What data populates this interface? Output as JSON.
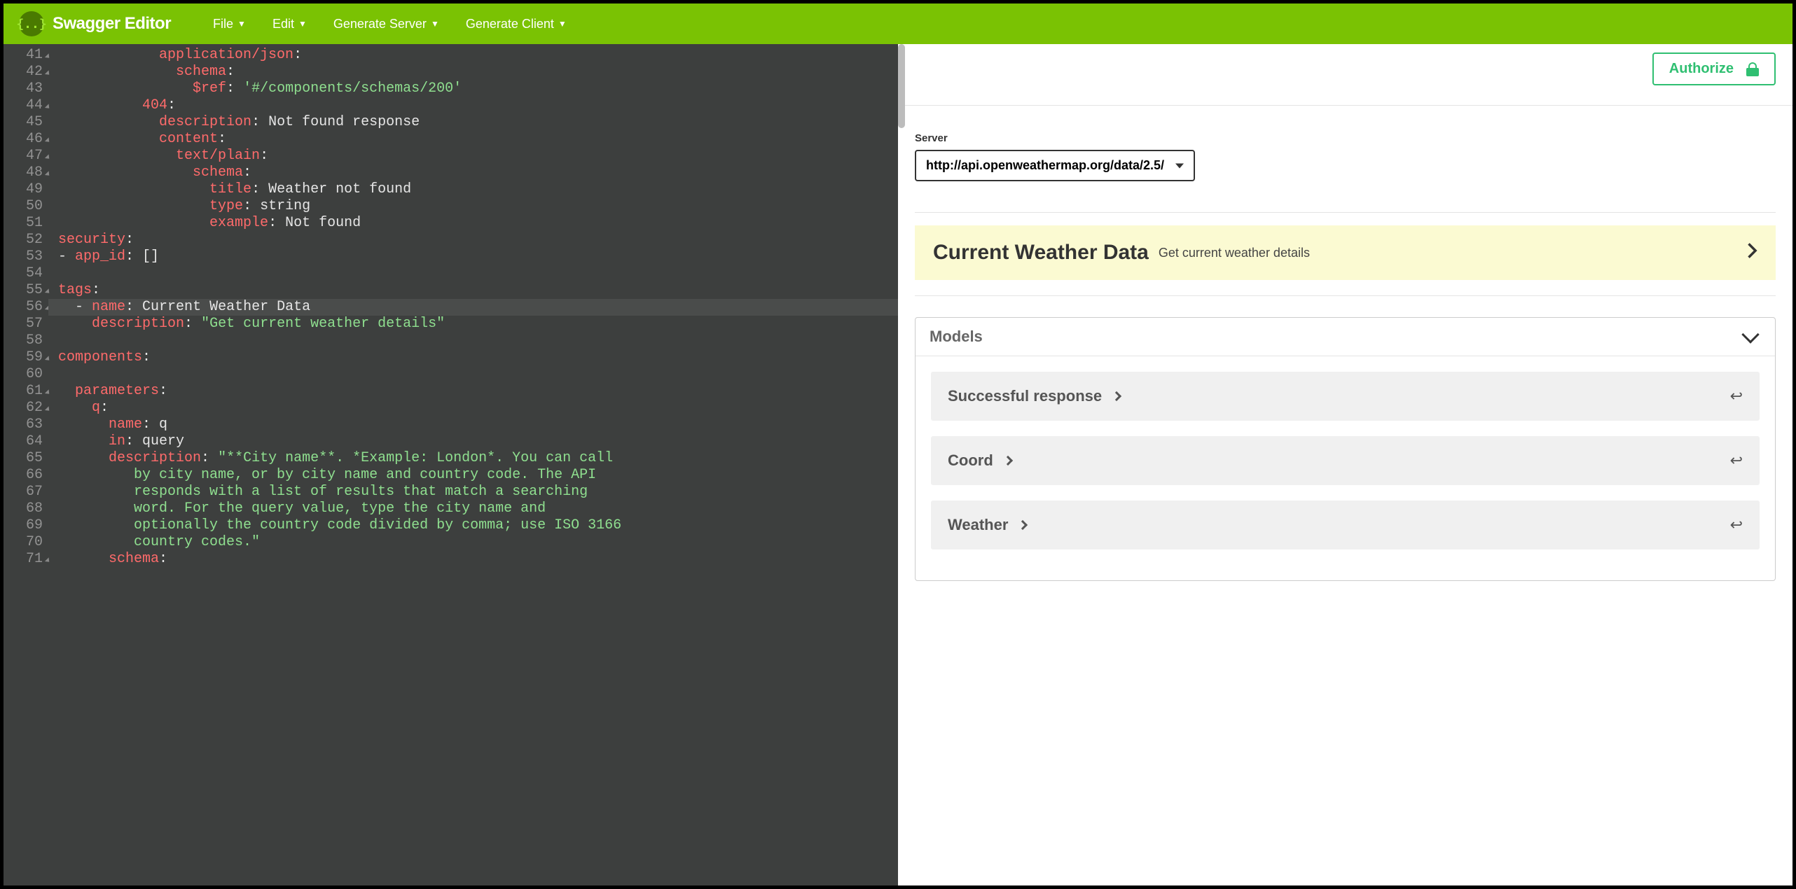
{
  "topbar": {
    "title": "Swagger Editor",
    "menu": [
      "File",
      "Edit",
      "Generate Server",
      "Generate Client"
    ]
  },
  "editor": {
    "first_line": 41,
    "highlighted_line": 56,
    "lines": [
      {
        "indent": 12,
        "fold": true,
        "tokens": [
          [
            "k",
            "application/json"
          ],
          [
            "p",
            ":"
          ]
        ]
      },
      {
        "indent": 14,
        "fold": true,
        "tokens": [
          [
            "k",
            "schema"
          ],
          [
            "p",
            ":"
          ]
        ]
      },
      {
        "indent": 16,
        "fold": false,
        "tokens": [
          [
            "k",
            "$ref"
          ],
          [
            "p",
            ": "
          ],
          [
            "s",
            "'#/components/schemas/200'"
          ]
        ]
      },
      {
        "indent": 10,
        "fold": true,
        "tokens": [
          [
            "k",
            "404"
          ],
          [
            "p",
            ":"
          ]
        ]
      },
      {
        "indent": 12,
        "fold": false,
        "tokens": [
          [
            "k",
            "description"
          ],
          [
            "p",
            ": Not found response"
          ]
        ]
      },
      {
        "indent": 12,
        "fold": true,
        "tokens": [
          [
            "k",
            "content"
          ],
          [
            "p",
            ":"
          ]
        ]
      },
      {
        "indent": 14,
        "fold": true,
        "tokens": [
          [
            "k",
            "text/plain"
          ],
          [
            "p",
            ":"
          ]
        ]
      },
      {
        "indent": 16,
        "fold": true,
        "tokens": [
          [
            "k",
            "schema"
          ],
          [
            "p",
            ":"
          ]
        ]
      },
      {
        "indent": 18,
        "fold": false,
        "tokens": [
          [
            "k",
            "title"
          ],
          [
            "p",
            ": Weather not found"
          ]
        ]
      },
      {
        "indent": 18,
        "fold": false,
        "tokens": [
          [
            "k",
            "type"
          ],
          [
            "p",
            ": string"
          ]
        ]
      },
      {
        "indent": 18,
        "fold": false,
        "tokens": [
          [
            "k",
            "example"
          ],
          [
            "p",
            ": Not found"
          ]
        ]
      },
      {
        "indent": 0,
        "fold": false,
        "tokens": [
          [
            "k",
            "security"
          ],
          [
            "p",
            ":"
          ]
        ]
      },
      {
        "indent": 0,
        "fold": false,
        "tokens": [
          [
            "p",
            "- "
          ],
          [
            "k",
            "app_id"
          ],
          [
            "p",
            ": "
          ],
          [
            "b",
            "[]"
          ]
        ]
      },
      {
        "indent": 0,
        "fold": false,
        "tokens": []
      },
      {
        "indent": 0,
        "fold": true,
        "tokens": [
          [
            "k",
            "tags"
          ],
          [
            "p",
            ":"
          ]
        ]
      },
      {
        "indent": 2,
        "fold": true,
        "tokens": [
          [
            "p",
            "- "
          ],
          [
            "k",
            "name"
          ],
          [
            "p",
            ": Current Weather Data"
          ]
        ]
      },
      {
        "indent": 4,
        "fold": false,
        "tokens": [
          [
            "k",
            "description"
          ],
          [
            "p",
            ": "
          ],
          [
            "s",
            "\"Get current weather details\""
          ]
        ]
      },
      {
        "indent": 0,
        "fold": false,
        "tokens": []
      },
      {
        "indent": 0,
        "fold": true,
        "tokens": [
          [
            "k",
            "components"
          ],
          [
            "p",
            ":"
          ]
        ]
      },
      {
        "indent": 0,
        "fold": false,
        "tokens": []
      },
      {
        "indent": 2,
        "fold": true,
        "tokens": [
          [
            "k",
            "parameters"
          ],
          [
            "p",
            ":"
          ]
        ]
      },
      {
        "indent": 4,
        "fold": true,
        "tokens": [
          [
            "k",
            "q"
          ],
          [
            "p",
            ":"
          ]
        ]
      },
      {
        "indent": 6,
        "fold": false,
        "tokens": [
          [
            "k",
            "name"
          ],
          [
            "p",
            ": q"
          ]
        ]
      },
      {
        "indent": 6,
        "fold": false,
        "tokens": [
          [
            "k",
            "in"
          ],
          [
            "p",
            ": query"
          ]
        ]
      },
      {
        "indent": 6,
        "fold": false,
        "tokens": [
          [
            "k",
            "description"
          ],
          [
            "p",
            ": "
          ],
          [
            "s",
            "\"**City name**. *Example: London*. You can call"
          ]
        ]
      },
      {
        "indent": 8,
        "fold": false,
        "tokens": [
          [
            "s",
            " by city name, or by city name and country code. The API"
          ]
        ]
      },
      {
        "indent": 8,
        "fold": false,
        "tokens": [
          [
            "s",
            " responds with a list of results that match a searching"
          ]
        ]
      },
      {
        "indent": 8,
        "fold": false,
        "tokens": [
          [
            "s",
            " word. For the query value, type the city name and"
          ]
        ]
      },
      {
        "indent": 8,
        "fold": false,
        "tokens": [
          [
            "s",
            " optionally the country code divided by comma; use ISO 3166"
          ]
        ]
      },
      {
        "indent": 8,
        "fold": false,
        "tokens": [
          [
            "s",
            " country codes.\""
          ]
        ]
      },
      {
        "indent": 6,
        "fold": true,
        "tokens": [
          [
            "k",
            "schema"
          ],
          [
            "p",
            ":"
          ]
        ]
      }
    ]
  },
  "panel": {
    "authorize_label": "Authorize",
    "server_label": "Server",
    "server_value": "http://api.openweathermap.org/data/2.5/",
    "tag": {
      "title": "Current Weather Data",
      "desc": "Get current weather details"
    },
    "models_header": "Models",
    "models": [
      {
        "name": "Successful response"
      },
      {
        "name": "Coord"
      },
      {
        "name": "Weather"
      }
    ]
  }
}
